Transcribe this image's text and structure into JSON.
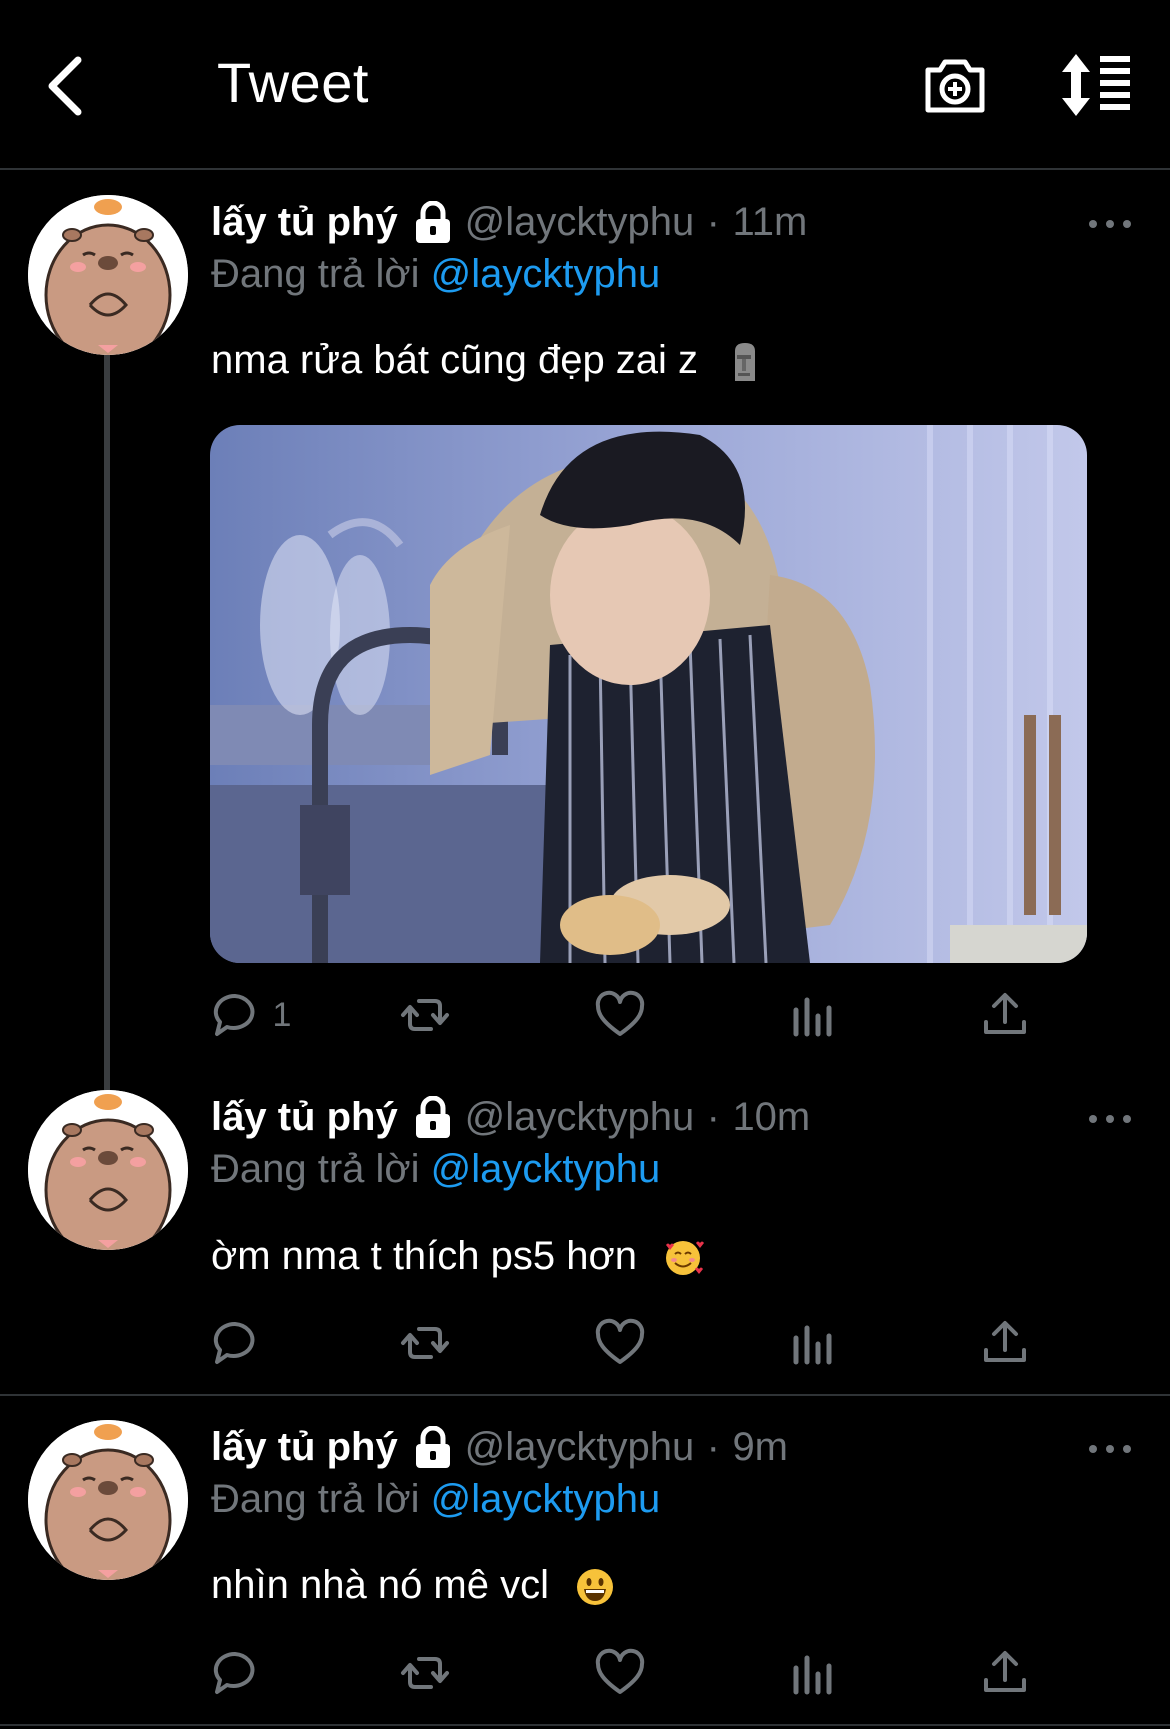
{
  "header": {
    "title": "Tweet"
  },
  "tweets": [
    {
      "name": "lấy tủ phý",
      "handle": "@laycktyphu",
      "sep": "·",
      "time": "11m",
      "reply_prefix": "Đang trả lời",
      "reply_to": "@laycktyphu",
      "text": "nma rửa bát cũng đẹp zai z",
      "emoji": "moai",
      "reply_count": "1",
      "has_media": true
    },
    {
      "name": "lấy tủ phý",
      "handle": "@laycktyphu",
      "sep": "·",
      "time": "10m",
      "reply_prefix": "Đang trả lời",
      "reply_to": "@laycktyphu",
      "text": "ờm nma t thích ps5 hơn",
      "emoji": "smiling-face-with-hearts",
      "reply_count": "",
      "has_media": false
    },
    {
      "name": "lấy tủ phý",
      "handle": "@laycktyphu",
      "sep": "·",
      "time": "9m",
      "reply_prefix": "Đang trả lời",
      "reply_to": "@laycktyphu",
      "text": "nhìn nhà nó mê vcl",
      "emoji": "grinning-face",
      "reply_count": "",
      "has_media": false
    }
  ],
  "colors": {
    "background": "#000000",
    "text": "#ffffff",
    "secondary": "#71767b",
    "link": "#1d9bf0",
    "divider": "#2f3336",
    "avatar_fur": "#c99a82"
  }
}
